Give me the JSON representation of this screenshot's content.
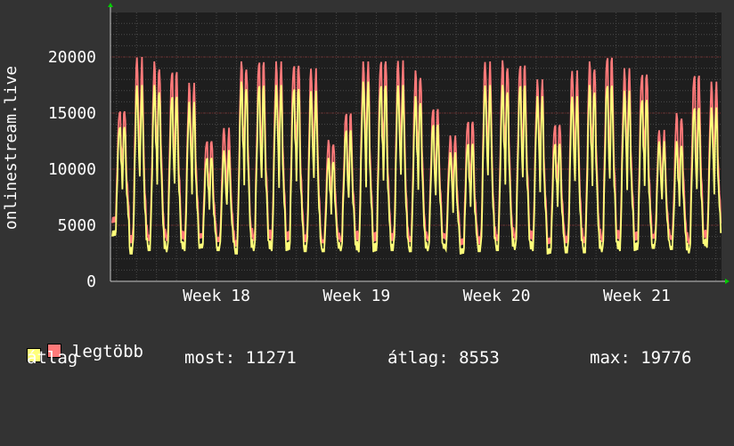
{
  "chart_data": {
    "type": "line",
    "ylabel": "onlinestream.live",
    "ylim": [
      0,
      24000
    ],
    "yticks": [
      0,
      5000,
      10000,
      15000,
      20000
    ],
    "ytick_labels": [
      "0",
      "5000",
      "10000",
      "15000",
      "20000"
    ],
    "x_tick_labels": [
      "Week 18",
      "Week 19",
      "Week 20",
      "Week 21"
    ],
    "grid": true,
    "days": 35,
    "series": [
      {
        "name": "legtöbb",
        "color": "#ff7a7a",
        "daily_peaks": [
          15400,
          20000,
          19600,
          18700,
          17700,
          12700,
          13700,
          19600,
          19600,
          19600,
          19600,
          19000,
          12600,
          15000,
          19600,
          20000,
          19700,
          18800,
          15400,
          13000,
          14500,
          19600,
          19700,
          19300,
          18000,
          14200,
          18800,
          19600,
          20000,
          19000,
          18800,
          13500,
          15000,
          18400,
          17800
        ],
        "daily_troughs": [
          5200,
          3400,
          3600,
          3600,
          3600,
          3800,
          3500,
          3100,
          3600,
          3600,
          3600,
          3500,
          3400,
          3500,
          3500,
          3500,
          3600,
          3500,
          3600,
          3700,
          3200,
          3300,
          3600,
          3700,
          3600,
          3300,
          3400,
          3400,
          3500,
          3600,
          3600,
          3800,
          3700,
          3300,
          3700
        ]
      },
      {
        "name": "átlag",
        "color": "#ffff7a",
        "daily_peaks": [
          14000,
          17500,
          17500,
          16500,
          16000,
          11200,
          11700,
          17800,
          17500,
          17500,
          17500,
          17000,
          11000,
          13500,
          17800,
          17800,
          17500,
          16500,
          14000,
          11500,
          12500,
          17500,
          17500,
          17500,
          16500,
          12500,
          16500,
          17500,
          17500,
          17000,
          16500,
          12500,
          12500,
          15500,
          15500
        ],
        "daily_troughs": [
          4000,
          2400,
          2700,
          2600,
          2700,
          2900,
          2700,
          2400,
          2700,
          2700,
          2700,
          2600,
          2600,
          2700,
          2600,
          2600,
          2700,
          2600,
          2700,
          2800,
          2400,
          2600,
          2700,
          2800,
          2700,
          2400,
          2500,
          2500,
          2600,
          2700,
          2700,
          2900,
          2800,
          2500,
          3000
        ]
      }
    ]
  },
  "legend": {
    "max_label": "legtöbb",
    "avg_label": "átlag",
    "max_color": "#ff7a7a",
    "avg_color": "#ffff7a",
    "now_text": "most: 11271",
    "avg_text": "átlag: 8553",
    "maxval_text": "max: 19776"
  }
}
